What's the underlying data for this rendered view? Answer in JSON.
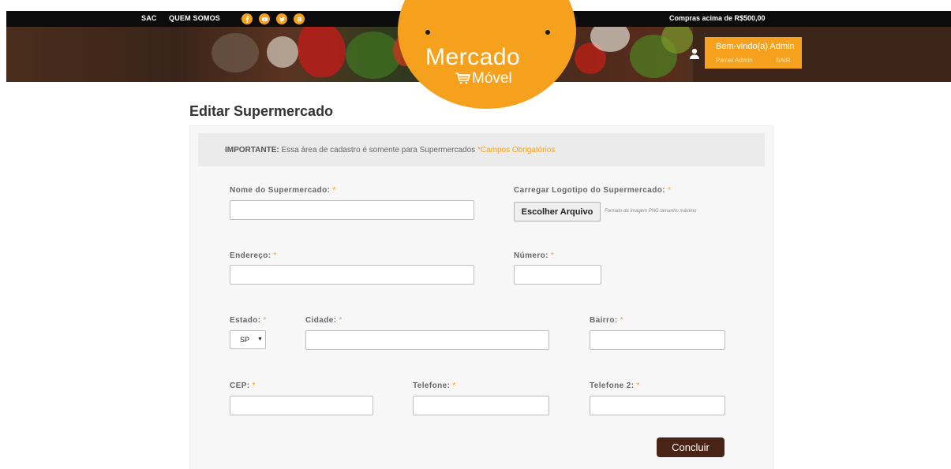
{
  "topbar": {
    "sac": "SAC",
    "quem_somos": "QUEM SOMOS",
    "promo": "Compras acima de R$500,00",
    "social": [
      "facebook-icon",
      "youtube-icon",
      "twitter-icon",
      "blogger-icon"
    ]
  },
  "logo": {
    "main": "Mercado",
    "sub": "Móvel"
  },
  "user": {
    "welcome": "Bem-vindo(a) Admin",
    "panel_link": "Painel Admin",
    "logout_link": "SAIR"
  },
  "page": {
    "title": "Editar Supermercado"
  },
  "notice": {
    "strong": "IMPORTANTE:",
    "text": " Essa área de cadastro é somente para Supermercados ",
    "required": "*Campos Obrigatórios"
  },
  "form": {
    "required_mark": "*",
    "nome_label": "Nome do Supermercado:",
    "logo_label": "Carregar Logotipo do Supermercado:",
    "file_button": "Escolher Arquivo",
    "file_hint": "Formato da Imagem PNG tamanho máximo",
    "endereco_label": "Endereço:",
    "numero_label": "Número:",
    "estado_label": "Estado:",
    "estado_value": "SP",
    "cidade_label": "Cidade:",
    "bairro_label": "Bairro:",
    "cep_label": "CEP:",
    "telefone_label": "Telefone:",
    "telefone2_label": "Telefone 2:",
    "submit": "Concluir"
  },
  "colors": {
    "accent": "#f5a11d",
    "button": "#4a2317",
    "topbar": "#0c0c0c"
  }
}
